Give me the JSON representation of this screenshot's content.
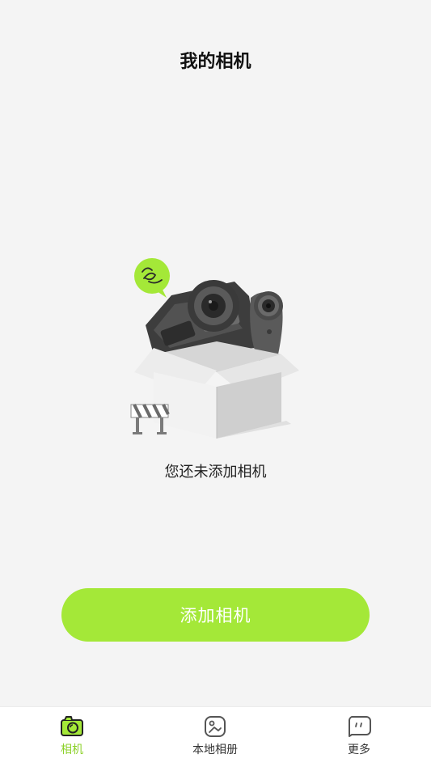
{
  "header": {
    "title": "我的相机"
  },
  "empty_state": {
    "message": "您还未添加相机",
    "illustration": "camera-box-illustration"
  },
  "actions": {
    "add_camera_label": "添加相机"
  },
  "tabbar": {
    "items": [
      {
        "label": "相机",
        "icon": "camera-icon",
        "active": true
      },
      {
        "label": "本地相册",
        "icon": "album-icon",
        "active": false
      },
      {
        "label": "更多",
        "icon": "more-icon",
        "active": false
      }
    ]
  },
  "colors": {
    "accent": "#a4e838",
    "accent_text": "#8cd12a",
    "background": "#f4f4f4",
    "tabbar_bg": "#ffffff"
  }
}
